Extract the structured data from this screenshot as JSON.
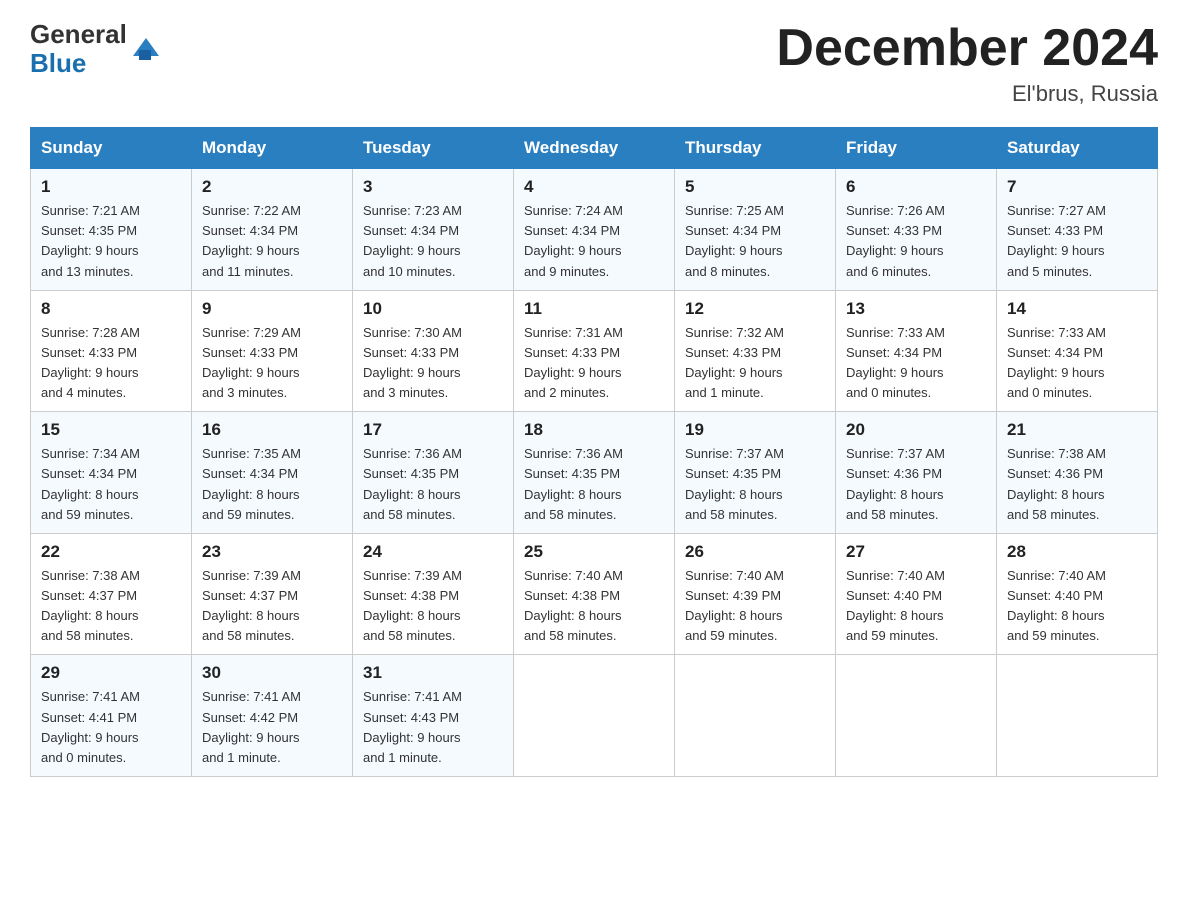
{
  "header": {
    "logo_text_general": "General",
    "logo_text_blue": "Blue",
    "month_title": "December 2024",
    "location": "El'brus, Russia"
  },
  "weekdays": [
    "Sunday",
    "Monday",
    "Tuesday",
    "Wednesday",
    "Thursday",
    "Friday",
    "Saturday"
  ],
  "weeks": [
    [
      {
        "day": "1",
        "info": "Sunrise: 7:21 AM\nSunset: 4:35 PM\nDaylight: 9 hours\nand 13 minutes."
      },
      {
        "day": "2",
        "info": "Sunrise: 7:22 AM\nSunset: 4:34 PM\nDaylight: 9 hours\nand 11 minutes."
      },
      {
        "day": "3",
        "info": "Sunrise: 7:23 AM\nSunset: 4:34 PM\nDaylight: 9 hours\nand 10 minutes."
      },
      {
        "day": "4",
        "info": "Sunrise: 7:24 AM\nSunset: 4:34 PM\nDaylight: 9 hours\nand 9 minutes."
      },
      {
        "day": "5",
        "info": "Sunrise: 7:25 AM\nSunset: 4:34 PM\nDaylight: 9 hours\nand 8 minutes."
      },
      {
        "day": "6",
        "info": "Sunrise: 7:26 AM\nSunset: 4:33 PM\nDaylight: 9 hours\nand 6 minutes."
      },
      {
        "day": "7",
        "info": "Sunrise: 7:27 AM\nSunset: 4:33 PM\nDaylight: 9 hours\nand 5 minutes."
      }
    ],
    [
      {
        "day": "8",
        "info": "Sunrise: 7:28 AM\nSunset: 4:33 PM\nDaylight: 9 hours\nand 4 minutes."
      },
      {
        "day": "9",
        "info": "Sunrise: 7:29 AM\nSunset: 4:33 PM\nDaylight: 9 hours\nand 3 minutes."
      },
      {
        "day": "10",
        "info": "Sunrise: 7:30 AM\nSunset: 4:33 PM\nDaylight: 9 hours\nand 3 minutes."
      },
      {
        "day": "11",
        "info": "Sunrise: 7:31 AM\nSunset: 4:33 PM\nDaylight: 9 hours\nand 2 minutes."
      },
      {
        "day": "12",
        "info": "Sunrise: 7:32 AM\nSunset: 4:33 PM\nDaylight: 9 hours\nand 1 minute."
      },
      {
        "day": "13",
        "info": "Sunrise: 7:33 AM\nSunset: 4:34 PM\nDaylight: 9 hours\nand 0 minutes."
      },
      {
        "day": "14",
        "info": "Sunrise: 7:33 AM\nSunset: 4:34 PM\nDaylight: 9 hours\nand 0 minutes."
      }
    ],
    [
      {
        "day": "15",
        "info": "Sunrise: 7:34 AM\nSunset: 4:34 PM\nDaylight: 8 hours\nand 59 minutes."
      },
      {
        "day": "16",
        "info": "Sunrise: 7:35 AM\nSunset: 4:34 PM\nDaylight: 8 hours\nand 59 minutes."
      },
      {
        "day": "17",
        "info": "Sunrise: 7:36 AM\nSunset: 4:35 PM\nDaylight: 8 hours\nand 58 minutes."
      },
      {
        "day": "18",
        "info": "Sunrise: 7:36 AM\nSunset: 4:35 PM\nDaylight: 8 hours\nand 58 minutes."
      },
      {
        "day": "19",
        "info": "Sunrise: 7:37 AM\nSunset: 4:35 PM\nDaylight: 8 hours\nand 58 minutes."
      },
      {
        "day": "20",
        "info": "Sunrise: 7:37 AM\nSunset: 4:36 PM\nDaylight: 8 hours\nand 58 minutes."
      },
      {
        "day": "21",
        "info": "Sunrise: 7:38 AM\nSunset: 4:36 PM\nDaylight: 8 hours\nand 58 minutes."
      }
    ],
    [
      {
        "day": "22",
        "info": "Sunrise: 7:38 AM\nSunset: 4:37 PM\nDaylight: 8 hours\nand 58 minutes."
      },
      {
        "day": "23",
        "info": "Sunrise: 7:39 AM\nSunset: 4:37 PM\nDaylight: 8 hours\nand 58 minutes."
      },
      {
        "day": "24",
        "info": "Sunrise: 7:39 AM\nSunset: 4:38 PM\nDaylight: 8 hours\nand 58 minutes."
      },
      {
        "day": "25",
        "info": "Sunrise: 7:40 AM\nSunset: 4:38 PM\nDaylight: 8 hours\nand 58 minutes."
      },
      {
        "day": "26",
        "info": "Sunrise: 7:40 AM\nSunset: 4:39 PM\nDaylight: 8 hours\nand 59 minutes."
      },
      {
        "day": "27",
        "info": "Sunrise: 7:40 AM\nSunset: 4:40 PM\nDaylight: 8 hours\nand 59 minutes."
      },
      {
        "day": "28",
        "info": "Sunrise: 7:40 AM\nSunset: 4:40 PM\nDaylight: 8 hours\nand 59 minutes."
      }
    ],
    [
      {
        "day": "29",
        "info": "Sunrise: 7:41 AM\nSunset: 4:41 PM\nDaylight: 9 hours\nand 0 minutes."
      },
      {
        "day": "30",
        "info": "Sunrise: 7:41 AM\nSunset: 4:42 PM\nDaylight: 9 hours\nand 1 minute."
      },
      {
        "day": "31",
        "info": "Sunrise: 7:41 AM\nSunset: 4:43 PM\nDaylight: 9 hours\nand 1 minute."
      },
      {
        "day": "",
        "info": ""
      },
      {
        "day": "",
        "info": ""
      },
      {
        "day": "",
        "info": ""
      },
      {
        "day": "",
        "info": ""
      }
    ]
  ]
}
